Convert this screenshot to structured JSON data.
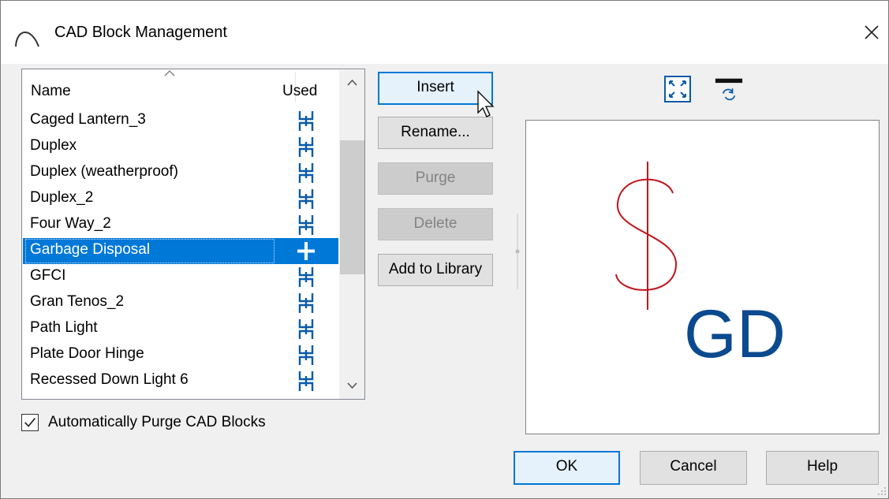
{
  "window": {
    "title": "CAD Block Management",
    "title_icon": "arc-icon",
    "close_icon": "close-icon"
  },
  "list": {
    "columns": {
      "name": "Name",
      "used": "Used"
    },
    "sort_icon": "sort-up-icon",
    "rows": [
      {
        "name": "Caged Lantern_3",
        "used_icon": "chain-link-icon"
      },
      {
        "name": "Duplex",
        "used_icon": "chain-link-icon"
      },
      {
        "name": "Duplex (weatherproof)",
        "used_icon": "chain-link-icon"
      },
      {
        "name": "Duplex_2",
        "used_icon": "chain-link-icon"
      },
      {
        "name": "Four Way_2",
        "used_icon": "chain-link-icon"
      },
      {
        "name": "Garbage Disposal",
        "used_icon": "plus-icon",
        "selected": true
      },
      {
        "name": "GFCI",
        "used_icon": "chain-link-icon"
      },
      {
        "name": "Gran Tenos_2",
        "used_icon": "chain-link-icon"
      },
      {
        "name": "Path Light",
        "used_icon": "chain-link-icon"
      },
      {
        "name": "Plate Door Hinge",
        "used_icon": "chain-link-icon"
      },
      {
        "name": "Recessed Down Light 6",
        "used_icon": "chain-link-icon"
      }
    ]
  },
  "auto_purge": {
    "label": "Automatically Purge CAD Blocks",
    "checked": true
  },
  "actions": {
    "insert": "Insert",
    "rename": "Rename...",
    "purge": "Purge",
    "delete": "Delete",
    "add_to_library": "Add to Library"
  },
  "preview_tools": {
    "fill_window_icon": "fill-window-icon",
    "rotate_icon": "rotate-view-icon"
  },
  "preview": {
    "symbol": "$",
    "text": "GD",
    "symbol_color": "#c0141c",
    "text_color": "#0b4a8e"
  },
  "footer": {
    "ok": "OK",
    "cancel": "Cancel",
    "help": "Help"
  },
  "colors": {
    "selection": "#0078d7",
    "chain_icon": "#0a5aa8",
    "primary_border": "#0078d7"
  }
}
